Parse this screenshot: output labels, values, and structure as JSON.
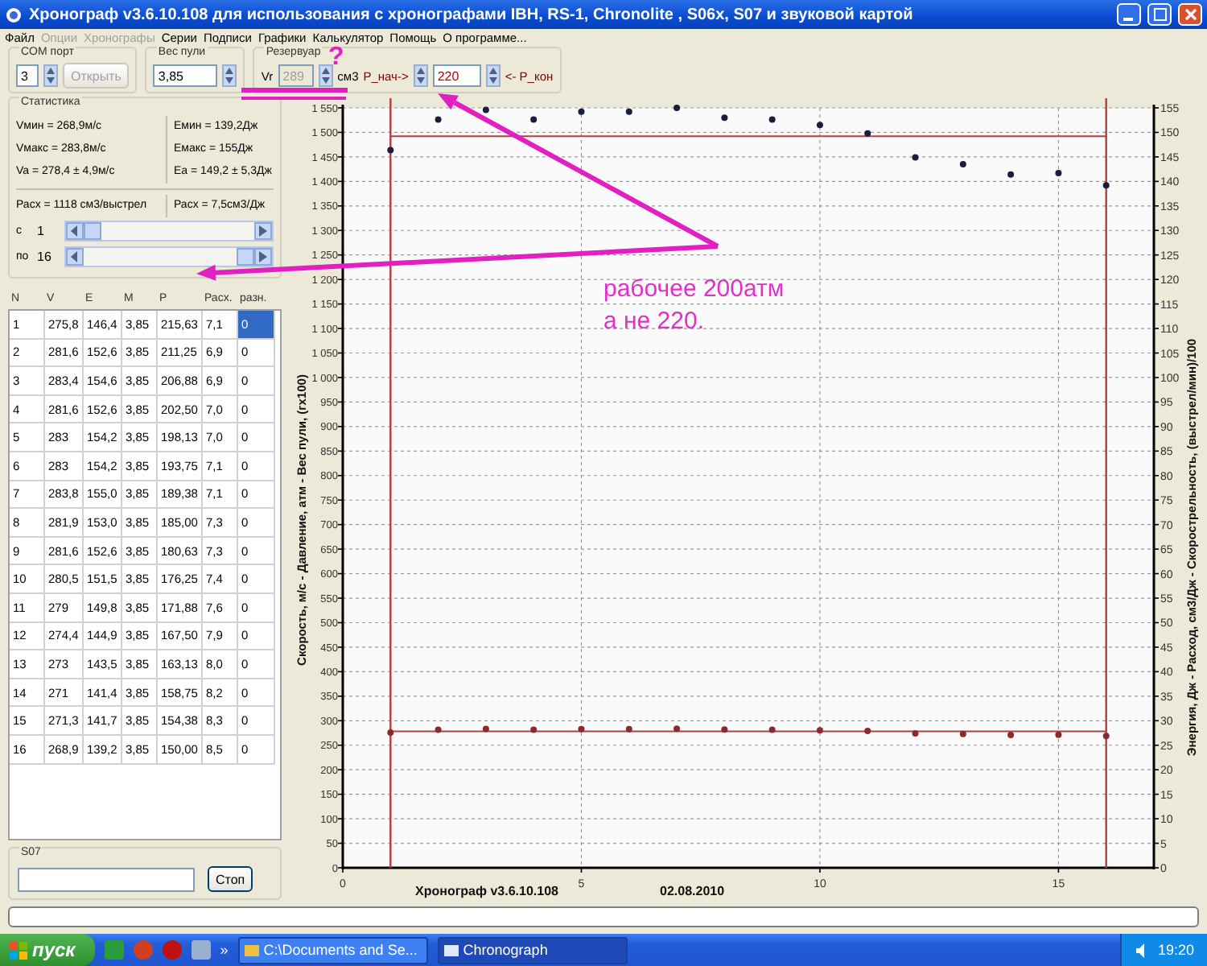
{
  "window": {
    "title": "Хронограф v3.6.10.108  для использования с хронографами  IBH, RS-1, Chronolite , S06x, S07 и звуковой картой"
  },
  "menu": [
    {
      "label": "Файл",
      "disabled": false
    },
    {
      "label": "Опции",
      "disabled": true
    },
    {
      "label": "Хронографы",
      "disabled": true
    },
    {
      "label": "Серии",
      "disabled": false
    },
    {
      "label": "Подписи",
      "disabled": false
    },
    {
      "label": "Графики",
      "disabled": false
    },
    {
      "label": "Калькулятор",
      "disabled": false
    },
    {
      "label": "Помощь",
      "disabled": false
    },
    {
      "label": "О программе...",
      "disabled": false
    }
  ],
  "com_port": {
    "title": "COM порт",
    "value": "3",
    "button": "Открыть"
  },
  "bullet_weight": {
    "title": "Вес пули",
    "value": "3,85"
  },
  "reservoir": {
    "title": "Резервуар",
    "vr_label": "Vr",
    "vr_value": "289",
    "vr_unit": "см3",
    "p_start_label": "P_нач->",
    "p_start_value": "220",
    "p_end_label": "<- P_кон"
  },
  "statistics": {
    "title": "Статистика",
    "lines": [
      [
        "Vмин = 268,9м/с",
        "Eмин = 139,2Дж"
      ],
      [
        "Vмакс = 283,8м/с",
        "Eмакс = 155Дж"
      ],
      [
        "Va = 278,4 ± 4,9м/с",
        "Ea = 149,2 ± 5,3Дж"
      ]
    ],
    "consumption": [
      "Расх = 1118 см3/выстрел",
      "Расх = 7,5см3/Дж"
    ],
    "range": [
      {
        "label": "с",
        "value": "1"
      },
      {
        "label": "по",
        "value": "16"
      }
    ]
  },
  "table": {
    "columns": [
      "N",
      "V",
      "E",
      "M",
      "P",
      "Расх.",
      "разн."
    ],
    "rows": [
      {
        "cells": [
          "1",
          "275,8",
          "146,4",
          "3,85",
          "215,63",
          "7,1",
          "0"
        ],
        "selected": true
      },
      {
        "cells": [
          "2",
          "281,6",
          "152,6",
          "3,85",
          "211,25",
          "6,9",
          "0"
        ],
        "selected": false
      },
      {
        "cells": [
          "3",
          "283,4",
          "154,6",
          "3,85",
          "206,88",
          "6,9",
          "0"
        ],
        "selected": false
      },
      {
        "cells": [
          "4",
          "281,6",
          "152,6",
          "3,85",
          "202,50",
          "7,0",
          "0"
        ],
        "selected": false
      },
      {
        "cells": [
          "5",
          "283",
          "154,2",
          "3,85",
          "198,13",
          "7,0",
          "0"
        ],
        "selected": false
      },
      {
        "cells": [
          "6",
          "283",
          "154,2",
          "3,85",
          "193,75",
          "7,1",
          "0"
        ],
        "selected": false
      },
      {
        "cells": [
          "7",
          "283,8",
          "155,0",
          "3,85",
          "189,38",
          "7,1",
          "0"
        ],
        "selected": false
      },
      {
        "cells": [
          "8",
          "281,9",
          "153,0",
          "3,85",
          "185,00",
          "7,3",
          "0"
        ],
        "selected": false
      },
      {
        "cells": [
          "9",
          "281,6",
          "152,6",
          "3,85",
          "180,63",
          "7,3",
          "0"
        ],
        "selected": false
      },
      {
        "cells": [
          "10",
          "280,5",
          "151,5",
          "3,85",
          "176,25",
          "7,4",
          "0"
        ],
        "selected": false
      },
      {
        "cells": [
          "11",
          "279",
          "149,8",
          "3,85",
          "171,88",
          "7,6",
          "0"
        ],
        "selected": false
      },
      {
        "cells": [
          "12",
          "274,4",
          "144,9",
          "3,85",
          "167,50",
          "7,9",
          "0"
        ],
        "selected": false
      },
      {
        "cells": [
          "13",
          "273",
          "143,5",
          "3,85",
          "163,13",
          "8,0",
          "0"
        ],
        "selected": false
      },
      {
        "cells": [
          "14",
          "271",
          "141,4",
          "3,85",
          "158,75",
          "8,2",
          "0"
        ],
        "selected": false
      },
      {
        "cells": [
          "15",
          "271,3",
          "141,7",
          "3,85",
          "154,38",
          "8,3",
          "0"
        ],
        "selected": false
      },
      {
        "cells": [
          "16",
          "268,9",
          "139,2",
          "3,85",
          "150,00",
          "8,5",
          "0"
        ],
        "selected": false
      }
    ]
  },
  "s07": {
    "title": "S07",
    "button": "Стоп"
  },
  "chart": {
    "footer": [
      "Хронограф v3.6.10.108",
      "02.08.2010"
    ],
    "chart_data": {
      "type": "scatter",
      "ylabel": "Скорость, м/с  - Давление, атм - Вес пули, (гх100)",
      "y2label": "Энергия, Дж  - Расход, см3/Дж - Скорострельность, (выстрел/мин)/100",
      "x": [
        1,
        2,
        3,
        4,
        5,
        6,
        7,
        8,
        9,
        10,
        11,
        12,
        13,
        14,
        15,
        16
      ],
      "series": [
        {
          "color": "#8b2a2a",
          "values": [
            275.8,
            281.6,
            283.4,
            281.6,
            283,
            283,
            283.8,
            281.9,
            281.6,
            280.5,
            279,
            274.4,
            273,
            271,
            271.3,
            268.9
          ]
        },
        {
          "color": "#1c1c3c",
          "axis": "y2",
          "values": [
            146.4,
            152.6,
            154.6,
            152.6,
            154.2,
            154.2,
            155.0,
            153.0,
            152.6,
            151.5,
            149.8,
            144.9,
            143.5,
            141.4,
            141.7,
            139.2
          ]
        }
      ],
      "grid": true,
      "ref_lines": [
        {
          "axis": "x",
          "value": 1
        },
        {
          "axis": "x",
          "value": 16
        },
        {
          "axis": "y",
          "value": 278.4
        },
        {
          "axis": "y2",
          "value": 149.2
        }
      ],
      "xlim": [
        0,
        17
      ],
      "ylim": [
        0,
        1550
      ],
      "y2lim": [
        0,
        155
      ],
      "xticks": [
        0,
        5,
        10,
        15
      ],
      "yticks": [
        0,
        50,
        100,
        150,
        200,
        250,
        300,
        350,
        400,
        450,
        500,
        550,
        600,
        650,
        700,
        750,
        800,
        850,
        900,
        950,
        {
          "value": 1000,
          "label": "1 000"
        },
        {
          "value": 1050,
          "label": "1 050"
        },
        {
          "value": 1100,
          "label": "1 100"
        },
        {
          "value": 1150,
          "label": "1 150"
        },
        {
          "value": 1200,
          "label": "1 200"
        },
        {
          "value": 1250,
          "label": "1 250"
        },
        {
          "value": 1300,
          "label": "1 300"
        },
        {
          "value": 1350,
          "label": "1 350"
        },
        {
          "value": 1400,
          "label": "1 400"
        },
        {
          "value": 1450,
          "label": "1 450"
        },
        {
          "value": 1500,
          "label": "1 500"
        },
        {
          "value": 1550,
          "label": "1 550"
        }
      ],
      "y2ticks": [
        0,
        5,
        10,
        15,
        20,
        25,
        30,
        35,
        40,
        45,
        50,
        55,
        60,
        65,
        70,
        75,
        80,
        85,
        90,
        95,
        100,
        105,
        110,
        115,
        120,
        125,
        130,
        135,
        140,
        145,
        150,
        155
      ]
    }
  },
  "progress": {
    "level": 0
  },
  "annotation": {
    "mark": "?",
    "note_lines": [
      "рабочее 200атм",
      "а не 220."
    ]
  },
  "taskbar": {
    "start": "пуск",
    "more": "»",
    "tasks": [
      {
        "label": "C:\\Documents and Se...",
        "selected": false
      },
      {
        "label": "Chronograph",
        "selected": true
      }
    ],
    "clock": "19:20"
  }
}
